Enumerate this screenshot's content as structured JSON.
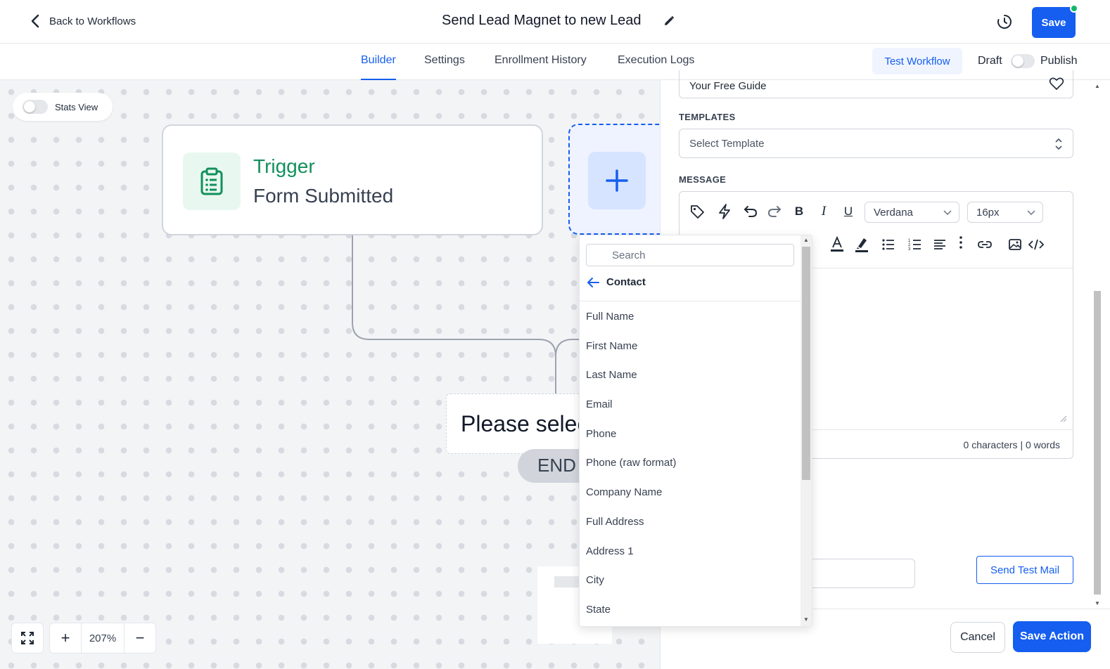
{
  "header": {
    "back_label": "Back to Workflows",
    "title": "Send Lead Magnet to new Lead",
    "save_label": "Save"
  },
  "tabs": [
    {
      "label": "Builder",
      "active": true
    },
    {
      "label": "Settings",
      "active": false
    },
    {
      "label": "Enrollment History",
      "active": false
    },
    {
      "label": "Execution Logs",
      "active": false
    }
  ],
  "actions": {
    "test_workflow": "Test Workflow",
    "draft_label": "Draft",
    "publish_label": "Publish",
    "publish_enabled": false
  },
  "canvas": {
    "stats_view_label": "Stats View",
    "stats_view_enabled": false,
    "trigger": {
      "title": "Trigger",
      "subtitle": "Form Submitted"
    },
    "add_action_icon": "plus-icon",
    "placeholder_text": "Please select",
    "end_label": "END",
    "zoom": "207%"
  },
  "panel": {
    "subject_value": "Your Free Guide",
    "templates_label": "TEMPLATES",
    "template_placeholder": "Select Template",
    "message_label": "MESSAGE",
    "font_family": "Verdana",
    "font_size": "16px",
    "char_count": "0 characters | 0 words",
    "send_test_label": "Send Test Mail",
    "cancel_label": "Cancel",
    "save_action_label": "Save Action"
  },
  "dropdown": {
    "search_placeholder": "Search",
    "back_label": "Contact",
    "items": [
      "Full Name",
      "First Name",
      "Last Name",
      "Email",
      "Phone",
      "Phone (raw format)",
      "Company Name",
      "Full Address",
      "Address 1",
      "City",
      "State"
    ]
  },
  "colors": {
    "primary": "#155eef",
    "trigger_green": "#12905b",
    "status_dot": "#12b76a"
  }
}
